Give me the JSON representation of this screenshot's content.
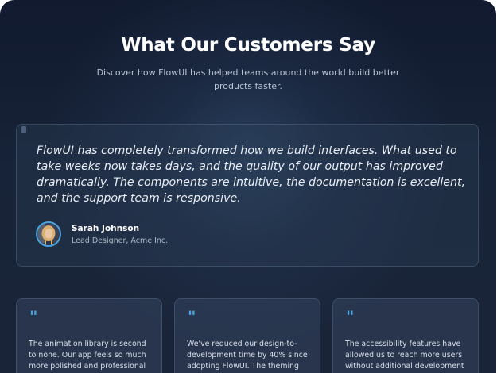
{
  "section": {
    "title": "What Our Customers Say",
    "subtitle": "Discover how FlowUI has helped teams around the world build better products faster."
  },
  "featured": {
    "quote": "FlowUI has completely transformed how we build interfaces. What used to take weeks now takes days, and the quality of our output has improved dramatically. The components are intuitive, the documentation is excellent, and the support team is responsive.",
    "author_name": "Sarah Johnson",
    "author_role": "Lead Designer, Acme Inc."
  },
  "testimonials": [
    {
      "quote_mark": "\"",
      "text": "The animation library is second to none. Our app feels so much more polished and professional"
    },
    {
      "quote_mark": "\"",
      "text": "We've reduced our design-to-development time by 40% since adopting FlowUI. The theming"
    },
    {
      "quote_mark": "\"",
      "text": "The accessibility features have allowed us to reach more users without additional development"
    }
  ],
  "colors": {
    "accent": "#4aa3e0",
    "background": "#151f33",
    "card_border": "#46566f"
  },
  "icons": {
    "quote": "quote-icon",
    "avatar": "avatar"
  }
}
